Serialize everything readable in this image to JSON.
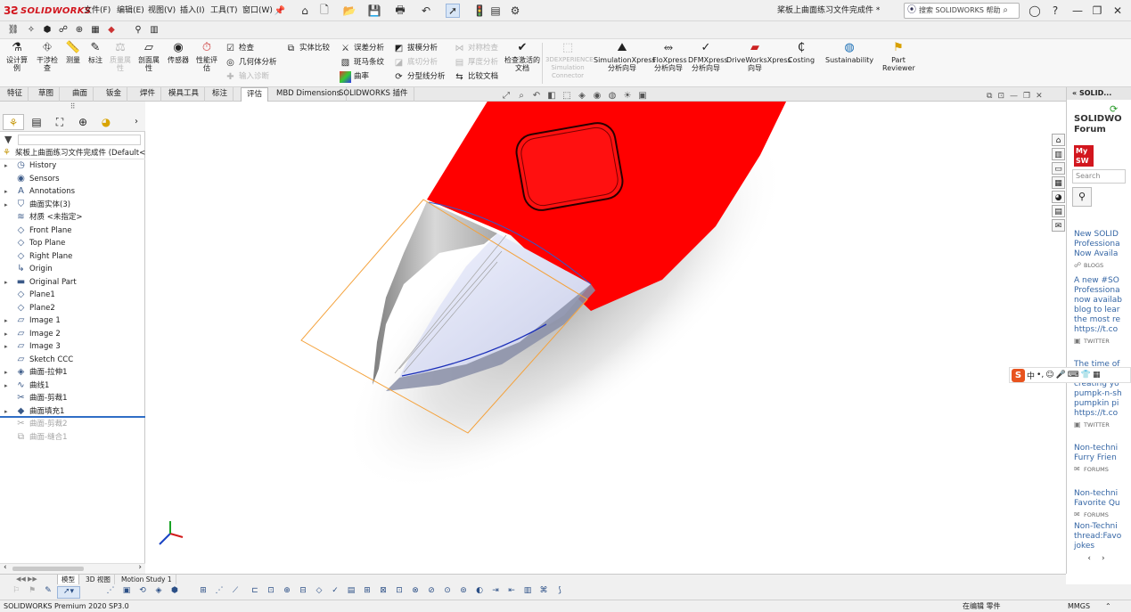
{
  "app": {
    "logo_text": "SOLIDWORKS",
    "doc_title": "桨板上曲面练习文件完成件 *",
    "menus": [
      "文件(F)",
      "编辑(E)",
      "视图(V)",
      "插入(I)",
      "工具(T)",
      "窗口(W)"
    ],
    "help_search_placeholder": "搜索 SOLIDWORKS 帮助",
    "colors": {
      "brand": "#d2161e",
      "model_red": "#ff0000",
      "selection_blue": "#2f6ec6",
      "plane_orange": "#f4a23c"
    }
  },
  "commands": {
    "big": [
      {
        "label": "设计算例",
        "icon": "design-study-icon"
      },
      {
        "label": "干涉检查",
        "icon": "interference-icon"
      },
      {
        "label": "测量",
        "icon": "measure-icon"
      },
      {
        "label": "标注",
        "icon": "markup-icon"
      },
      {
        "label": "质量属性",
        "icon": "mass-properties-icon",
        "dim": true
      },
      {
        "label": "剖面属性",
        "icon": "section-properties-icon"
      },
      {
        "label": "传感器",
        "icon": "sensor-icon"
      },
      {
        "label": "性能评估",
        "icon": "performance-icon"
      }
    ],
    "small_col1": [
      {
        "label": "检查",
        "dim": false
      },
      {
        "label": "几何体分析",
        "dim": false
      },
      {
        "label": "输入诊断",
        "dim": true
      }
    ],
    "small_col2": [
      {
        "label": "实体比较",
        "dim": false
      }
    ],
    "small_col3": [
      {
        "label": "误差分析",
        "dim": false
      },
      {
        "label": "斑马条纹",
        "dim": false
      },
      {
        "label": "曲率",
        "dim": false
      }
    ],
    "small_col4": [
      {
        "label": "拔模分析",
        "dim": false
      },
      {
        "label": "底切分析",
        "dim": true
      },
      {
        "label": "分型线分析",
        "dim": false
      }
    ],
    "small_col5": [
      {
        "label": "对称检查",
        "dim": true
      },
      {
        "label": "厚度分析",
        "dim": true
      },
      {
        "label": "比较文档",
        "dim": false
      }
    ],
    "check_active": "检查激活的文档",
    "addins": [
      {
        "label": "3DEXPERIENCE Simulation Connector",
        "dim": true
      },
      {
        "label": "SimulationXpress 分析向导",
        "dim": false
      },
      {
        "label": "FloXpress 分析向导",
        "dim": false
      },
      {
        "label": "DFMXpress 分析向导",
        "dim": false
      },
      {
        "label": "DriveWorksXpress 向导",
        "dim": false
      },
      {
        "label": "Costing",
        "dim": false
      },
      {
        "label": "Sustainability",
        "dim": false
      },
      {
        "label": "Part Reviewer",
        "dim": false
      }
    ]
  },
  "tabs": [
    "特征",
    "草图",
    "曲面",
    "钣金",
    "焊件",
    "模具工具",
    "标注",
    "评估",
    "MBD Dimensions",
    "SOLIDWORKS 插件"
  ],
  "active_tab": "评估",
  "tree": {
    "root": "桨板上曲面练习文件完成件 (Default<<Default",
    "items": [
      {
        "label": "History",
        "expand": true,
        "icon": "history-icon",
        "dim": false
      },
      {
        "label": "Sensors",
        "expand": false,
        "icon": "sensors-icon",
        "dim": false
      },
      {
        "label": "Annotations",
        "expand": true,
        "icon": "annotations-icon",
        "dim": false
      },
      {
        "label": "曲面实体(3)",
        "expand": true,
        "icon": "surface-bodies-icon",
        "dim": false
      },
      {
        "label": "材质 <未指定>",
        "expand": false,
        "icon": "material-icon",
        "dim": false
      },
      {
        "label": "Front Plane",
        "expand": false,
        "icon": "plane-icon",
        "dim": false
      },
      {
        "label": "Top Plane",
        "expand": false,
        "icon": "plane-icon",
        "dim": false
      },
      {
        "label": "Right Plane",
        "expand": false,
        "icon": "plane-icon",
        "dim": false
      },
      {
        "label": "Origin",
        "expand": false,
        "icon": "origin-icon",
        "dim": false
      },
      {
        "label": "Original Part",
        "expand": true,
        "icon": "folder-icon",
        "dim": false
      },
      {
        "label": "Plane1",
        "expand": false,
        "icon": "plane-icon",
        "dim": false
      },
      {
        "label": "Plane2",
        "expand": false,
        "icon": "plane-icon",
        "dim": false
      },
      {
        "label": "Image 1",
        "expand": true,
        "icon": "sketch-icon",
        "dim": false
      },
      {
        "label": "Image 2",
        "expand": true,
        "icon": "sketch-icon",
        "dim": false
      },
      {
        "label": "Image 3",
        "expand": true,
        "icon": "sketch-icon",
        "dim": false
      },
      {
        "label": "Sketch CCC",
        "expand": false,
        "icon": "sketch-icon",
        "dim": false
      },
      {
        "label": "曲面-拉伸1",
        "expand": true,
        "icon": "surface-extrude-icon",
        "dim": false
      },
      {
        "label": "曲线1",
        "expand": true,
        "icon": "curve-icon",
        "dim": false
      },
      {
        "label": "曲面-剪裁1",
        "expand": false,
        "icon": "surface-trim-icon",
        "dim": false
      },
      {
        "label": "曲面填充1",
        "expand": true,
        "icon": "surface-fill-icon",
        "dim": false
      },
      {
        "label": "曲面-剪裁2",
        "expand": false,
        "icon": "surface-trim-icon",
        "dim": true
      },
      {
        "label": "曲面-缝合1",
        "expand": false,
        "icon": "surface-knit-icon",
        "dim": true
      }
    ]
  },
  "taskpane": {
    "header": "SOLID...",
    "title_line1": "SOLIDWO",
    "title_line2": "Forum",
    "mysw": "My SW",
    "search_placeholder": "Search",
    "feed": [
      {
        "lines": [
          "New SOLID",
          "Professiona",
          "Now Availa"
        ],
        "category": "BLOGS"
      },
      {
        "lines": [
          "A new #SO",
          "Professiona",
          "now availab",
          "blog to lear",
          "the most re",
          "https://t.co"
        ],
        "category": "TWITTER"
      },
      {
        "lines": [
          "The time of",
          "cozy foo bu",
          "creating yo",
          "pumpk-n-sh",
          "pumpkin pi",
          "https://t.co"
        ],
        "category": "TWITTER"
      },
      {
        "lines": [
          "Non-techni",
          "Furry Frien"
        ],
        "category": "FORUMS"
      },
      {
        "lines": [
          "Non-techni",
          "Favorite Qu"
        ],
        "category": "FORUMS"
      },
      {
        "lines": [
          "Non-Techni",
          "thread:Favo",
          "jokes"
        ],
        "category": ""
      }
    ]
  },
  "bottom_tabs": [
    "模型",
    "3D 视图",
    "Motion Study 1"
  ],
  "active_bottom_tab": "模型",
  "status": {
    "left": "SOLIDWORKS Premium 2020 SP3.0",
    "editing": "在编辑 零件",
    "units": "MMGS"
  },
  "ime": {
    "mode": "中"
  }
}
